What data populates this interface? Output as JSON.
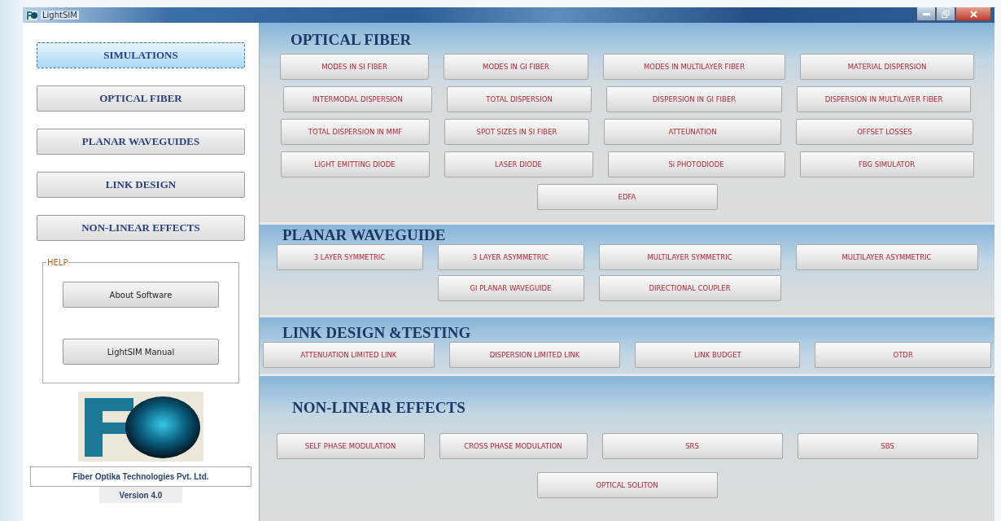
{
  "window": {
    "title": "LightSIM"
  },
  "nav": [
    {
      "label": "SIMULATIONS",
      "selected": true
    },
    {
      "label": "OPTICAL FIBER",
      "selected": false
    },
    {
      "label": "PLANAR WAVEGUIDES",
      "selected": false
    },
    {
      "label": "LINK DESIGN",
      "selected": false
    },
    {
      "label": "NON-LINEAR EFFECTS",
      "selected": false
    }
  ],
  "help": {
    "legend": "HELP",
    "buttons": [
      "About Software",
      "LightSIM Manual"
    ]
  },
  "company": "Fiber Optika Technologies Pvt. Ltd.",
  "version": "Version 4.0",
  "sections": [
    {
      "kind": "fiber",
      "title": "OPTICAL FIBER",
      "rows": [
        [
          "MODES IN SI FIBER",
          "MODES IN GI FIBER",
          "MODES IN MULTILAYER FIBER",
          "MATERIAL DISPERSION"
        ],
        [
          "INTERMODAL DISPERSION",
          "TOTAL DISPERSION",
          "DISPERSION IN GI FIBER",
          "DISPERSION IN MULTILAYER FIBER"
        ],
        [
          "TOTAL DISPERSION IN MMF",
          "SPOT SIZES IN SI FIBER",
          "ATTEUNATION",
          "OFFSET LOSSES"
        ],
        [
          "LIGHT EMITTING DIODE",
          "LASER DIODE",
          "Si PHOTODIODE",
          "FBG SIMULATOR"
        ],
        [
          "EDFA"
        ]
      ]
    },
    {
      "kind": "planar",
      "title": "PLANAR WAVEGUIDE",
      "rows": [
        [
          "3 LAYER SYMMETRIC",
          "3 LAYER ASYMMETRIC",
          "MULTILAYER SYMMETRIC",
          "MULTILAYER ASYMMETRIC"
        ],
        [
          "",
          "GI PLANAR WAVEGUIDE",
          "DIRECTIONAL COUPLER",
          ""
        ]
      ]
    },
    {
      "kind": "link",
      "title": "LINK DESIGN &TESTING",
      "rows": [
        [
          "ATTENUATION LIMITED LINK",
          "DISPERSION LIMITED LINK",
          "LINK BUDGET",
          "OTDR"
        ]
      ]
    },
    {
      "kind": "nonlinear",
      "title": "NON-LINEAR EFFECTS",
      "rows": [
        [
          "SELF PHASE MODULATION",
          "CROSS PHASE MODULATION",
          "SRS",
          "SBS"
        ],
        [
          "OPTICAL SOLITON"
        ]
      ]
    }
  ]
}
